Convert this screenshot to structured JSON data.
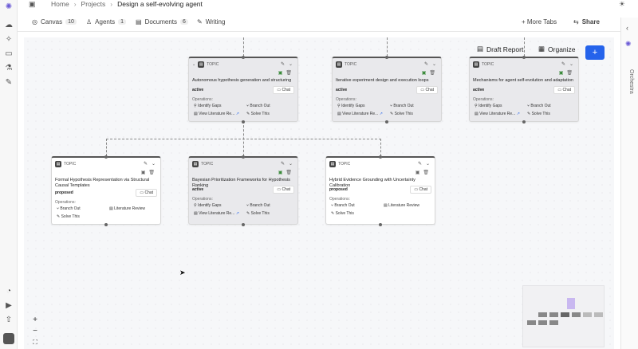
{
  "breadcrumb": {
    "home": "Home",
    "projects": "Projects",
    "current": "Design a self-evolving agent"
  },
  "tabs": [
    {
      "label": "Canvas",
      "count": "10"
    },
    {
      "label": "Agents",
      "count": "1"
    },
    {
      "label": "Documents",
      "count": "6"
    },
    {
      "label": "Writing",
      "count": ""
    }
  ],
  "more_tabs": "+ More Tabs",
  "share": "Share",
  "draft_report": "Draft Report",
  "organize": "Organize",
  "add": "+",
  "orchestra": "Orchestra",
  "cards": [
    {
      "type": "TOPIC",
      "title": "Autonomous hypothesis generation and structuring",
      "status": "active",
      "chat": "Chat",
      "ops_label": "Operations:",
      "ops": [
        "Identify Gaps",
        "Branch Out",
        "View Literature Re...",
        "Solve This"
      ]
    },
    {
      "type": "TOPIC",
      "title": "Iterative experiment design and execution loops",
      "status": "active",
      "chat": "Chat",
      "ops_label": "Operations:",
      "ops": [
        "Identify Gaps",
        "Branch Out",
        "View Literature Re...",
        "Solve This"
      ]
    },
    {
      "type": "TOPIC",
      "title": "Mechanisms for agent self-evolution and adaptation",
      "status": "active",
      "chat": "Chat",
      "ops_label": "Operations:",
      "ops": [
        "Identify Gaps",
        "Branch Out",
        "View Literature Re...",
        "Solve This"
      ]
    },
    {
      "type": "TOPIC",
      "title": "Formal Hypothesis Representation via Structural Causal Templates",
      "status": "proposed",
      "chat": "Chat",
      "ops_label": "Operations:",
      "ops": [
        "Branch Out",
        "Literature Review",
        "Solve This"
      ]
    },
    {
      "type": "TOPIC",
      "title": "Bayesian Prioritization Frameworks for Hypothesis Ranking",
      "status": "active",
      "chat": "Chat",
      "ops_label": "Operations:",
      "ops": [
        "Identify Gaps",
        "Branch Out",
        "View Literature Re...",
        "Solve This"
      ]
    },
    {
      "type": "TOPIC",
      "title": "Hybrid Evidence Grounding with Uncertainty Calibration",
      "status": "proposed",
      "chat": "Chat",
      "ops_label": "Operations:",
      "ops": [
        "Branch Out",
        "Literature Review",
        "Solve This"
      ]
    }
  ],
  "zoom": {
    "in": "+",
    "out": "−",
    "fit": "⛶"
  }
}
